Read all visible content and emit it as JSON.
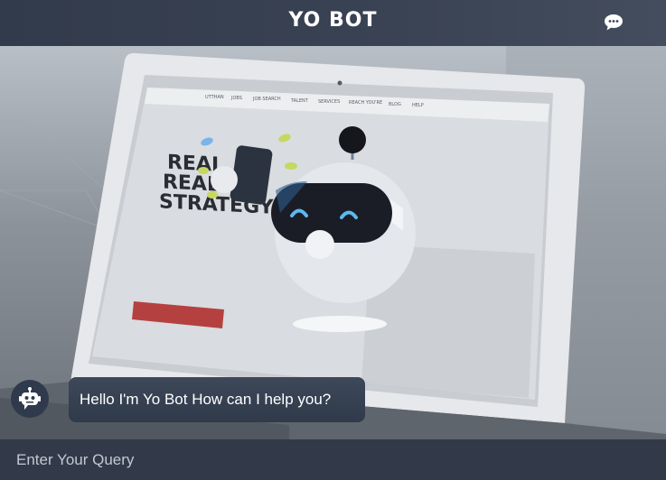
{
  "header": {
    "brand": "YO BOT",
    "chat_icon": "chat-bubble-icon"
  },
  "screen": {
    "nav_items": [
      "UTTHAN",
      "JOBS",
      "JOB SEARCH",
      "TALENT",
      "SERVICES",
      "REACH YOU'RE",
      "BLOG",
      "HELP"
    ],
    "headline_lines": [
      "REAL",
      "REAL",
      "STRATEGY"
    ],
    "cta_label": ""
  },
  "chat": {
    "bot_avatar_icon": "robot-icon",
    "messages": [
      {
        "from": "bot",
        "text": "Hello I'm Yo Bot How can I help you?"
      }
    ]
  },
  "input": {
    "placeholder": "Enter Your Query",
    "value": ""
  },
  "colors": {
    "header": "#323b4b",
    "bubble": "#36414f",
    "footer": "#323a4a",
    "text": "#ffffff"
  }
}
